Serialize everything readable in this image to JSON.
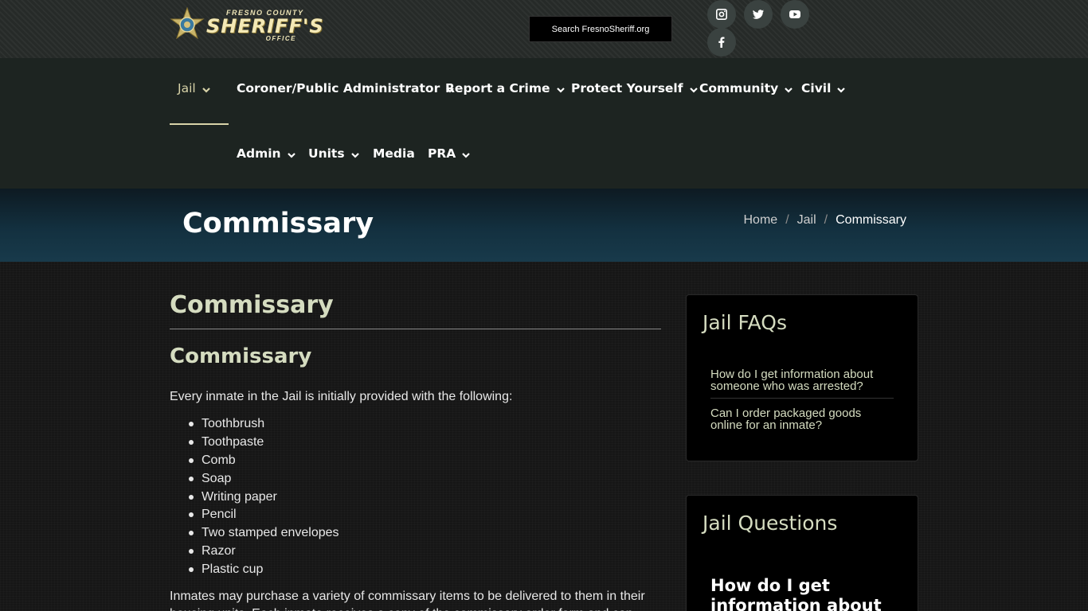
{
  "header": {
    "logo": {
      "county": "FRESNO COUNTY",
      "main": "SHERIFF'S",
      "office": "OFFICE"
    },
    "search_label": "Search FresnoSheriff.org",
    "social": [
      {
        "name": "instagram-icon"
      },
      {
        "name": "twitter-icon"
      },
      {
        "name": "youtube-icon"
      },
      {
        "name": "facebook-icon"
      }
    ]
  },
  "nav": {
    "items": [
      {
        "label": "Jail",
        "has_dropdown": true,
        "active": true
      },
      {
        "label": "Coroner/Public Administrator",
        "has_dropdown": true
      },
      {
        "label": "Report a Crime",
        "has_dropdown": true
      },
      {
        "label": "Protect Yourself",
        "has_dropdown": true
      },
      {
        "label": "Community",
        "has_dropdown": true
      },
      {
        "label": "Civil",
        "has_dropdown": true
      },
      {
        "label": "Admin",
        "has_dropdown": true
      },
      {
        "label": "Units",
        "has_dropdown": true
      },
      {
        "label": "Media",
        "has_dropdown": false
      },
      {
        "label": "PRA",
        "has_dropdown": true
      }
    ]
  },
  "banner": {
    "title": "Commissary",
    "breadcrumb": [
      "Home",
      "Jail",
      "Commissary"
    ]
  },
  "main": {
    "heading": "Commissary",
    "subheading": "Commissary",
    "intro": "Every inmate in the Jail is initially provided with the following:",
    "items": [
      "Toothbrush",
      "Toothpaste",
      "Comb",
      "Soap",
      "Writing paper",
      "Pencil",
      "Two stamped envelopes",
      "Razor",
      "Plastic cup"
    ],
    "paragraph": "Inmates may purchase a variety of commissary items to be delivered to them in their housing units. Each inmate receives a copy of the commissary order form and can"
  },
  "sidebar": {
    "faq": {
      "title": "Jail FAQs",
      "links": [
        "How do I get information about someone who was arrested?",
        "Can I order packaged goods online for an inmate?"
      ]
    },
    "questions": {
      "title": "Jail Questions",
      "first": "How do I get information about"
    }
  },
  "colors": {
    "accent": "#d5dcc0",
    "nav_bg": "#1d2421",
    "topbar_bg": "#262a28",
    "banner_bg": "#13303f"
  }
}
